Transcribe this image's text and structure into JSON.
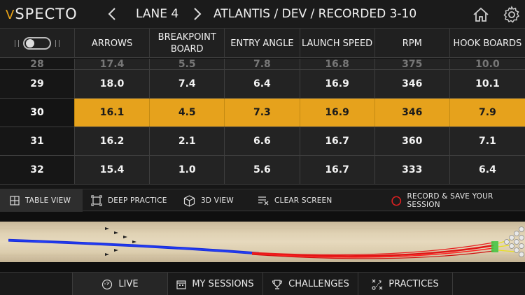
{
  "header": {
    "logo": "SPECTO",
    "lane": "LANE 4",
    "session": "ATLANTIS / DEV / RECORDED 3-10",
    "icons": [
      "chevron-left-icon",
      "chevron-right-icon",
      "home-icon",
      "gear-icon"
    ]
  },
  "table": {
    "columns": [
      "ARROWS",
      "BREAKPOINT BOARD",
      "ENTRY ANGLE",
      "LAUNCH SPEED",
      "RPM",
      "HOOK BOARDS"
    ],
    "partial_row": {
      "shot": "28",
      "values": [
        "17.4",
        "5.5",
        "7.8",
        "16.8",
        "375",
        "10.0"
      ]
    },
    "rows": [
      {
        "shot": "29",
        "values": [
          "18.0",
          "7.4",
          "6.4",
          "16.9",
          "346",
          "10.1"
        ]
      },
      {
        "shot": "30",
        "values": [
          "16.1",
          "4.5",
          "7.3",
          "16.9",
          "346",
          "7.9"
        ]
      },
      {
        "shot": "31",
        "values": [
          "16.2",
          "2.1",
          "6.6",
          "16.7",
          "360",
          "7.1"
        ]
      },
      {
        "shot": "32",
        "values": [
          "15.4",
          "1.0",
          "5.6",
          "16.7",
          "333",
          "6.4"
        ]
      }
    ],
    "highlight_color": "#e6a21c"
  },
  "toolbar": {
    "table_view": "TABLE VIEW",
    "deep_practice": "DEEP PRACTICE",
    "view_3d": "3D VIEW",
    "clear_screen": "CLEAR SCREEN",
    "record": "RECORD & SAVE YOUR SESSION",
    "record_color": "#e02020"
  },
  "bottom_nav": {
    "live": "LIVE",
    "my_sessions": "MY SESSIONS",
    "challenges": "CHALLENGES",
    "practices": "PRACTICES"
  }
}
